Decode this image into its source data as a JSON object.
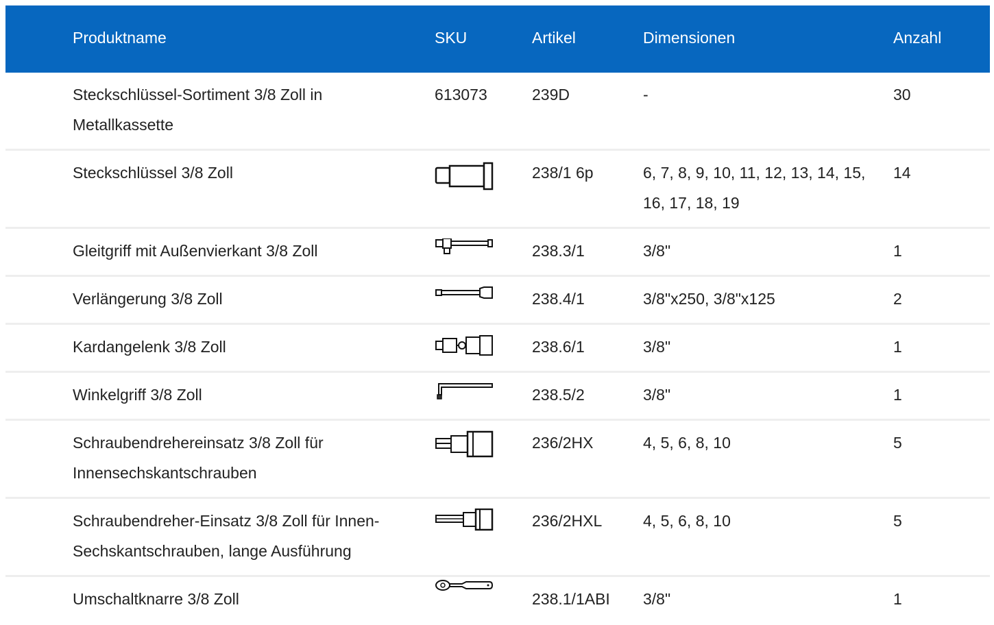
{
  "columns": {
    "name": "Produktname",
    "sku": "SKU",
    "article": "Artikel",
    "dimensions": "Dimensionen",
    "quantity": "Anzahl"
  },
  "rows": [
    {
      "name": "Steckschlüssel-Sortiment 3/8 Zoll in Metallkassette",
      "sku": "613073",
      "article": "239D",
      "dimensions": "-",
      "quantity": "30"
    },
    {
      "name": "Steckschlüssel 3/8 Zoll",
      "sku_icon": "socket-icon",
      "article": "238/1 6p",
      "dimensions": "6, 7, 8, 9, 10, 11, 12, 13, 14, 15, 16, 17, 18, 19",
      "quantity": "14"
    },
    {
      "name": "Gleitgriff mit Außenvierkant 3/8 Zoll",
      "sku_icon": "sliding-t-handle-icon",
      "article": "238.3/1",
      "dimensions": "3/8\"",
      "quantity": "1"
    },
    {
      "name": "Verlängerung 3/8 Zoll",
      "sku_icon": "extension-bar-icon",
      "article": "238.4/1",
      "dimensions": "3/8\"x250, 3/8\"x125",
      "quantity": "2"
    },
    {
      "name": "Kardangelenk 3/8 Zoll",
      "sku_icon": "universal-joint-icon",
      "article": "238.6/1",
      "dimensions": "3/8\"",
      "quantity": "1"
    },
    {
      "name": "Winkelgriff 3/8 Zoll",
      "sku_icon": "angle-handle-icon",
      "article": "238.5/2",
      "dimensions": "3/8\"",
      "quantity": "1"
    },
    {
      "name": "Schraubendrehereinsatz 3/8 Zoll für Innensechskantschrauben",
      "sku_icon": "hex-bit-socket-icon",
      "article": "236/2HX",
      "dimensions": "4, 5, 6, 8, 10",
      "quantity": "5"
    },
    {
      "name": "Schraubendreher-Einsatz 3/8 Zoll für Innen-Sechskantschrauben, lange Ausführung",
      "sku_icon": "long-hex-bit-socket-icon",
      "article": "236/2HXL",
      "dimensions": "4, 5, 6, 8, 10",
      "quantity": "5"
    },
    {
      "name": "Umschaltknarre 3/8 Zoll",
      "sku_icon": "ratchet-icon",
      "article": "238.1/1ABI",
      "dimensions": "3/8\"",
      "quantity": "1"
    }
  ],
  "colors": {
    "header_bg": "#0767bf",
    "header_text": "#ffffff",
    "row_divider": "#eeeeee"
  }
}
